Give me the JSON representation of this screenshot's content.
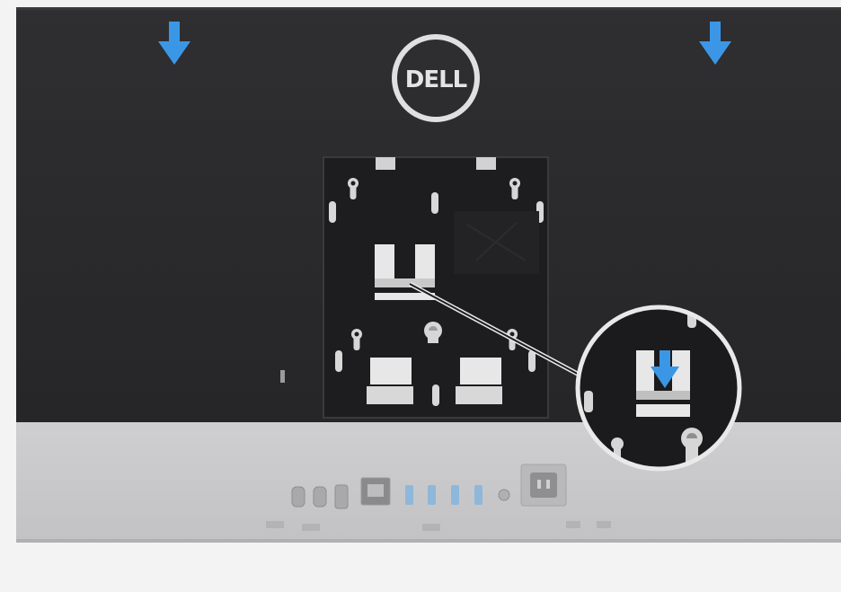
{
  "image": {
    "description_free": true,
    "brand_logo_text": "DELL",
    "colors": {
      "background": "#f3f3f4",
      "back_cover": "#2c2c2e",
      "stand_bay": "#1d1d1f",
      "io_panel": "#c9c9cb",
      "arrow": "#3b97e6",
      "callout_ring": "#e9e9e9"
    },
    "icons": [
      "down-arrow-icon",
      "dell-logo",
      "callout-magnifier"
    ]
  }
}
